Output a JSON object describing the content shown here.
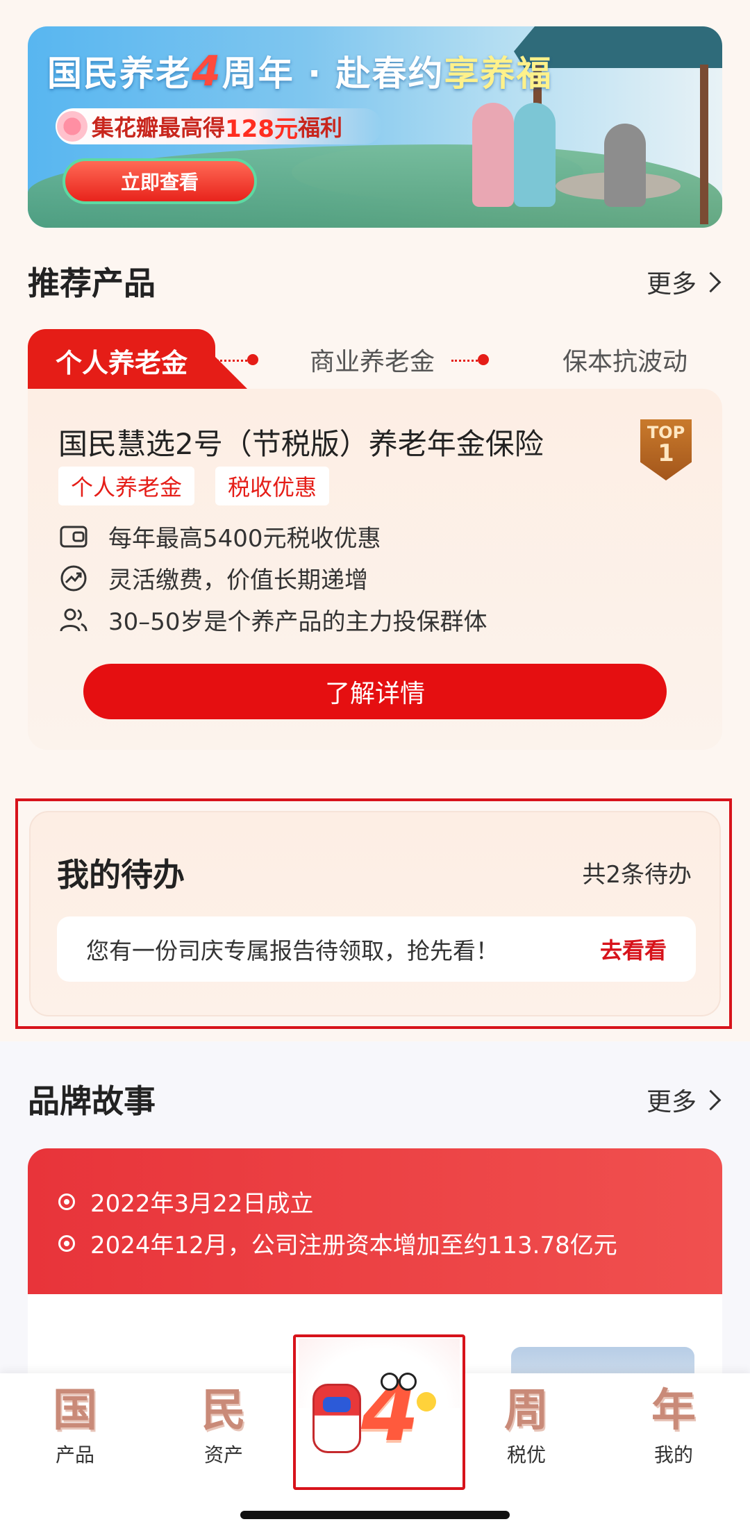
{
  "banner": {
    "title_a": "国民养老",
    "title_num": "4",
    "title_b": "周年 · 赴春约",
    "title_hl": "享养福",
    "subtitle_a": "集花瓣最高得",
    "subtitle_num": "128元",
    "subtitle_b": "福利",
    "button": "立即查看"
  },
  "recommend": {
    "title": "推荐产品",
    "more": "更多",
    "tabs": [
      "个人养老金",
      "商业养老金",
      "保本抗波动"
    ],
    "card": {
      "title": "国民慧选2号（节税版）养老年金保险",
      "badge_top": "TOP",
      "badge_rank": "1",
      "tags": [
        "个人养老金",
        "税收优惠"
      ],
      "features": [
        "每年最高5400元税收优惠",
        "灵活缴费，价值长期递增",
        "30–50岁是个养产品的主力投保群体"
      ],
      "cta": "了解详情"
    }
  },
  "todo": {
    "title": "我的待办",
    "count": "共2条待办",
    "item_text": "您有一份司庆专属报告待领取，抢先看！",
    "item_action": "去看看"
  },
  "brand": {
    "title": "品牌故事",
    "more": "更多",
    "lines": [
      "2022年3月22日成立",
      "2024年12月，公司注册资本增加至约113.78亿元"
    ]
  },
  "nav": {
    "items": [
      {
        "glyph": "国",
        "label": "产品"
      },
      {
        "glyph": "民",
        "label": "资产"
      },
      {
        "glyph": "周",
        "label": "税优"
      },
      {
        "glyph": "年",
        "label": "我的"
      }
    ],
    "center_num": "4"
  },
  "colors": {
    "brand_red": "#e51d17",
    "highlight_red": "#d7131b"
  }
}
